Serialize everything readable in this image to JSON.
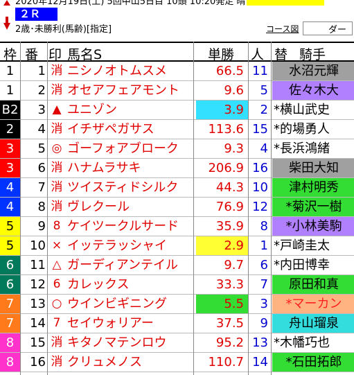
{
  "top": {
    "date_strip": "2020年12月19日(土) 5回中山5日目  10頭  10:20発走  晴",
    "race_badge": "２Ｒ",
    "race_condition": "2歳･未勝利(馬齢)[指定]",
    "course_link": "コース図",
    "course_value": "ダー"
  },
  "header": {
    "waku": "枠",
    "umaban": "番",
    "mark": "印",
    "name": "馬名S",
    "odds": "単勝",
    "popularity": "人",
    "change": "替",
    "jockey": "騎手"
  },
  "colors": {
    "red_text": "#e00000",
    "blue_text": "#0000d0",
    "waku": {
      "1": "#ffffff",
      "2": "#000000",
      "3": "#ff0000",
      "4": "#0033ff",
      "5": "#ffff00",
      "6": "#007a5a",
      "7": "#ff7a1a",
      "8": "#ff33cc"
    }
  },
  "rows": [
    {
      "waku": "1",
      "umaban": "1",
      "mark": "消",
      "name": "ニシノオトムスメ",
      "odds": "66.5",
      "pop": "11",
      "jockey": "水沼元輝",
      "wakuBg": "#ffffff",
      "wakuFg": "#000000",
      "oddsBg": "",
      "jkBg": "#a0a0a0",
      "jkFg": "#000000"
    },
    {
      "waku": "1",
      "umaban": "2",
      "mark": "消",
      "name": "オセアフェアモント",
      "odds": "9.6",
      "pop": "5",
      "jockey": "佐々木大",
      "wakuBg": "#ffffff",
      "wakuFg": "#000000",
      "oddsBg": "",
      "jkBg": "#b080ff",
      "jkFg": "#000000"
    },
    {
      "waku": "B2",
      "umaban": "3",
      "mark": "▲",
      "name": "ユニゾン",
      "odds": "3.9",
      "pop": "2",
      "jockey": "*横山武史",
      "wakuBg": "#000000",
      "wakuFg": "#ffffff",
      "oddsBg": "#33e0ff",
      "jkBg": "#ffffff",
      "jkFg": "#000000"
    },
    {
      "waku": "2",
      "umaban": "4",
      "mark": "消",
      "name": "イチザペガサス",
      "odds": "113.6",
      "pop": "15",
      "jockey": "*的場勇人",
      "wakuBg": "#000000",
      "wakuFg": "#ffffff",
      "oddsBg": "",
      "jkBg": "#ffffff",
      "jkFg": "#000000"
    },
    {
      "waku": "3",
      "umaban": "5",
      "mark": "◎",
      "name": "ゴーフォアブローク",
      "odds": "9.3",
      "pop": "4",
      "jockey": "*長浜鴻緒",
      "wakuBg": "#ff0000",
      "wakuFg": "#ffffff",
      "oddsBg": "",
      "jkBg": "#ffffff",
      "jkFg": "#000000"
    },
    {
      "waku": "3",
      "umaban": "6",
      "mark": "消",
      "name": "ハナムラサキ",
      "odds": "206.9",
      "pop": "16",
      "jockey": "柴田大知",
      "wakuBg": "#ff0000",
      "wakuFg": "#ffffff",
      "oddsBg": "",
      "jkBg": "#a0a0a0",
      "jkFg": "#000000"
    },
    {
      "waku": "4",
      "umaban": "7",
      "mark": "消",
      "name": "ツイスティドシルク",
      "odds": "44.3",
      "pop": "10",
      "jockey": "津村明秀",
      "wakuBg": "#0033ff",
      "wakuFg": "#ffffff",
      "oddsBg": "",
      "jkBg": "#33dd33",
      "jkFg": "#000000"
    },
    {
      "waku": "4",
      "umaban": "8",
      "mark": "消",
      "name": "ヴレクール",
      "odds": "76.9",
      "pop": "12",
      "jockey": "*菊沢一樹",
      "wakuBg": "#0033ff",
      "wakuFg": "#ffffff",
      "oddsBg": "",
      "jkBg": "#33dd33",
      "jkFg": "#000000"
    },
    {
      "waku": "5",
      "umaban": "9",
      "mark": "8",
      "name": "ケイツークルサード",
      "odds": "35.9",
      "pop": "8",
      "jockey": "*小林美駒",
      "wakuBg": "#ffff00",
      "wakuFg": "#000000",
      "oddsBg": "",
      "jkBg": "#b080ff",
      "jkFg": "#000000"
    },
    {
      "waku": "5",
      "umaban": "10",
      "mark": "×",
      "name": "イッテラッシャイ",
      "odds": "2.9",
      "pop": "1",
      "jockey": "*戸崎圭太",
      "wakuBg": "#ffff00",
      "wakuFg": "#000000",
      "oddsBg": "#ffff33",
      "jkBg": "#ffffff",
      "jkFg": "#000000"
    },
    {
      "waku": "6",
      "umaban": "11",
      "mark": "△",
      "name": "ガーディアンテイル",
      "odds": "9.7",
      "pop": "6",
      "jockey": "*内田博幸",
      "wakuBg": "#007a5a",
      "wakuFg": "#ffffff",
      "oddsBg": "",
      "jkBg": "#ffffff",
      "jkFg": "#000000"
    },
    {
      "waku": "6",
      "umaban": "12",
      "mark": "6",
      "name": "カレックス",
      "odds": "33.3",
      "pop": "7",
      "jockey": "原田和真",
      "wakuBg": "#007a5a",
      "wakuFg": "#ffffff",
      "oddsBg": "",
      "jkBg": "#33dd33",
      "jkFg": "#000000"
    },
    {
      "waku": "7",
      "umaban": "13",
      "mark": "○",
      "name": "ウインビギニング",
      "odds": "5.5",
      "pop": "3",
      "jockey": "*マーカン",
      "wakuBg": "#ff7a1a",
      "wakuFg": "#ffffff",
      "oddsBg": "#33dd33",
      "jkBg": "#ffb380",
      "jkFg": "#ff2020"
    },
    {
      "waku": "7",
      "umaban": "14",
      "mark": "7",
      "name": "セイウォリアー",
      "odds": "37.5",
      "pop": "9",
      "jockey": "舟山瑠泉",
      "wakuBg": "#ff7a1a",
      "wakuFg": "#ffffff",
      "oddsBg": "",
      "jkBg": "#33dddd",
      "jkFg": "#000000"
    },
    {
      "waku": "8",
      "umaban": "15",
      "mark": "消",
      "name": "キタノマテンロウ",
      "odds": "95.2",
      "pop": "13",
      "jockey": "*木幡巧也",
      "wakuBg": "#ff33cc",
      "wakuFg": "#ffffff",
      "oddsBg": "",
      "jkBg": "#ffffff",
      "jkFg": "#000000"
    },
    {
      "waku": "8",
      "umaban": "16",
      "mark": "消",
      "name": "クリュメノス",
      "odds": "110.7",
      "pop": "14",
      "jockey": "*石田拓郎",
      "wakuBg": "#ff33cc",
      "wakuFg": "#ffffff",
      "oddsBg": "",
      "jkBg": "#33dd33",
      "jkFg": "#000000"
    }
  ]
}
